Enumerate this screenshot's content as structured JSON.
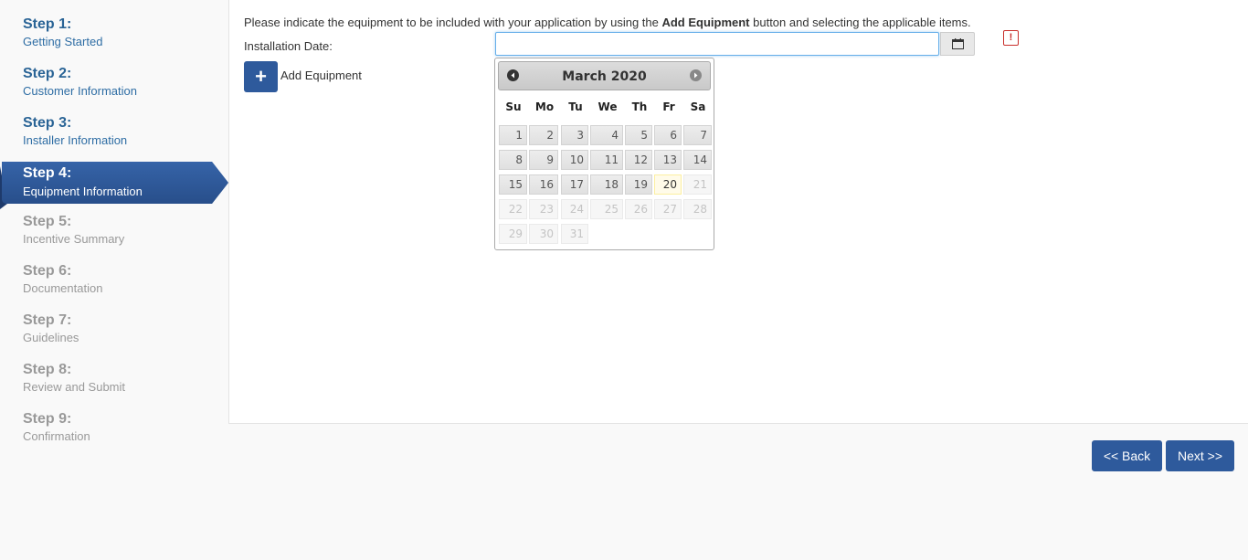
{
  "steps": [
    {
      "num": "Step 1:",
      "name": "Getting Started",
      "state": "done"
    },
    {
      "num": "Step 2:",
      "name": "Customer Information",
      "state": "done"
    },
    {
      "num": "Step 3:",
      "name": "Installer Information",
      "state": "done"
    },
    {
      "num": "Step 4:",
      "name": "Equipment Information",
      "state": "active"
    },
    {
      "num": "Step 5:",
      "name": "Incentive Summary",
      "state": "todo"
    },
    {
      "num": "Step 6:",
      "name": "Documentation",
      "state": "todo"
    },
    {
      "num": "Step 7:",
      "name": "Guidelines",
      "state": "todo"
    },
    {
      "num": "Step 8:",
      "name": "Review and Submit",
      "state": "todo"
    },
    {
      "num": "Step 9:",
      "name": "Confirmation",
      "state": "todo"
    }
  ],
  "main": {
    "instructions_pre": "Please indicate the equipment to be included with your application by using the ",
    "instructions_bold": "Add Equipment",
    "instructions_post": " button and selecting the applicable items.",
    "date_label": "Installation Date:",
    "date_value": "",
    "add_equipment_label": "Add Equipment",
    "add_icon": "+",
    "error_icon": "!"
  },
  "datepicker": {
    "title": "March 2020",
    "weekdays": [
      "Su",
      "Mo",
      "Tu",
      "We",
      "Th",
      "Fr",
      "Sa"
    ],
    "weeks": [
      [
        {
          "d": "1",
          "s": "on"
        },
        {
          "d": "2",
          "s": "on"
        },
        {
          "d": "3",
          "s": "on"
        },
        {
          "d": "4",
          "s": "on"
        },
        {
          "d": "5",
          "s": "on"
        },
        {
          "d": "6",
          "s": "on"
        },
        {
          "d": "7",
          "s": "on"
        }
      ],
      [
        {
          "d": "8",
          "s": "on"
        },
        {
          "d": "9",
          "s": "on"
        },
        {
          "d": "10",
          "s": "on"
        },
        {
          "d": "11",
          "s": "on"
        },
        {
          "d": "12",
          "s": "on"
        },
        {
          "d": "13",
          "s": "on"
        },
        {
          "d": "14",
          "s": "on"
        }
      ],
      [
        {
          "d": "15",
          "s": "on"
        },
        {
          "d": "16",
          "s": "on"
        },
        {
          "d": "17",
          "s": "on"
        },
        {
          "d": "18",
          "s": "on"
        },
        {
          "d": "19",
          "s": "on"
        },
        {
          "d": "20",
          "s": "today"
        },
        {
          "d": "21",
          "s": "off"
        }
      ],
      [
        {
          "d": "22",
          "s": "off"
        },
        {
          "d": "23",
          "s": "off"
        },
        {
          "d": "24",
          "s": "off"
        },
        {
          "d": "25",
          "s": "off"
        },
        {
          "d": "26",
          "s": "off"
        },
        {
          "d": "27",
          "s": "off"
        },
        {
          "d": "28",
          "s": "off"
        }
      ],
      [
        {
          "d": "29",
          "s": "off"
        },
        {
          "d": "30",
          "s": "off"
        },
        {
          "d": "31",
          "s": "off"
        }
      ]
    ]
  },
  "nav": {
    "back_label": "<< Back",
    "next_label": "Next >>"
  },
  "colors": {
    "accent": "#2e5a9c",
    "link": "#2e6da4",
    "muted": "#999999",
    "error": "#c9302c"
  }
}
